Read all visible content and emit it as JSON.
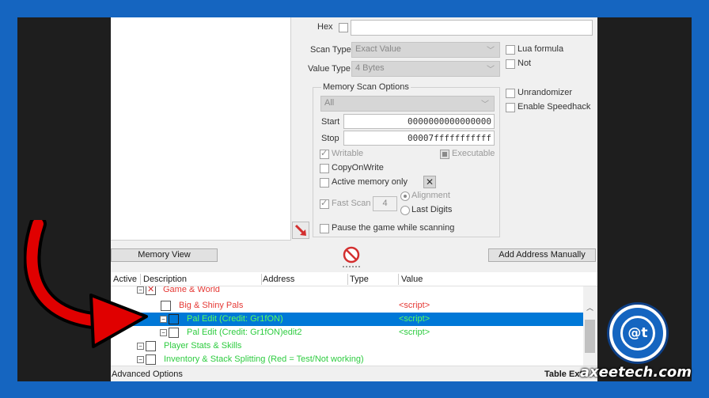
{
  "scan": {
    "hex_label": "Hex",
    "scan_type_label": "Scan Type",
    "scan_type_value": "Exact Value",
    "value_type_label": "Value Type",
    "value_type_value": "4 Bytes",
    "lua_formula_label": "Lua formula",
    "not_label": "Not",
    "unrandomizer_label": "Unrandomizer",
    "enable_speedhack_label": "Enable Speedhack"
  },
  "memory_options": {
    "title": "Memory Scan Options",
    "region_value": "All",
    "start_label": "Start",
    "start_value": "0000000000000000",
    "stop_label": "Stop",
    "stop_value": "00007fffffffffff",
    "writable_label": "Writable",
    "executable_label": "Executable",
    "copyonwrite_label": "CopyOnWrite",
    "active_memory_label": "Active memory only",
    "fast_scan_label": "Fast Scan",
    "fast_scan_value": "4",
    "alignment_label": "Alignment",
    "last_digits_label": "Last Digits",
    "pause_label": "Pause the game while scanning"
  },
  "buttons": {
    "memory_view": "Memory View",
    "add_address": "Add Address Manually"
  },
  "table": {
    "headers": [
      "Active",
      "Description",
      "Address",
      "Type",
      "Value"
    ],
    "rows": [
      {
        "desc": "Game & World",
        "value": ""
      },
      {
        "desc": "Big & Shiny Pals",
        "value": "<script>"
      },
      {
        "desc": "Pal Edit (Credit: Gr1fON)",
        "value": "<script>"
      },
      {
        "desc": "Pal Edit (Credit: Gr1fON)edit2",
        "value": "<script>"
      },
      {
        "desc": "Player Stats & Skills",
        "value": ""
      },
      {
        "desc": "Inventory & Stack Splitting (Red = Test/Not working)",
        "value": ""
      }
    ]
  },
  "status": {
    "left": "Advanced Options",
    "right": "Table Ext"
  },
  "watermark": {
    "text": "axeetech.com",
    "logo_text": "@t"
  },
  "colors": {
    "selection": "#0078d7",
    "red_text": "#e53935",
    "green_text": "#2ecc40",
    "background": "#1565c0"
  }
}
